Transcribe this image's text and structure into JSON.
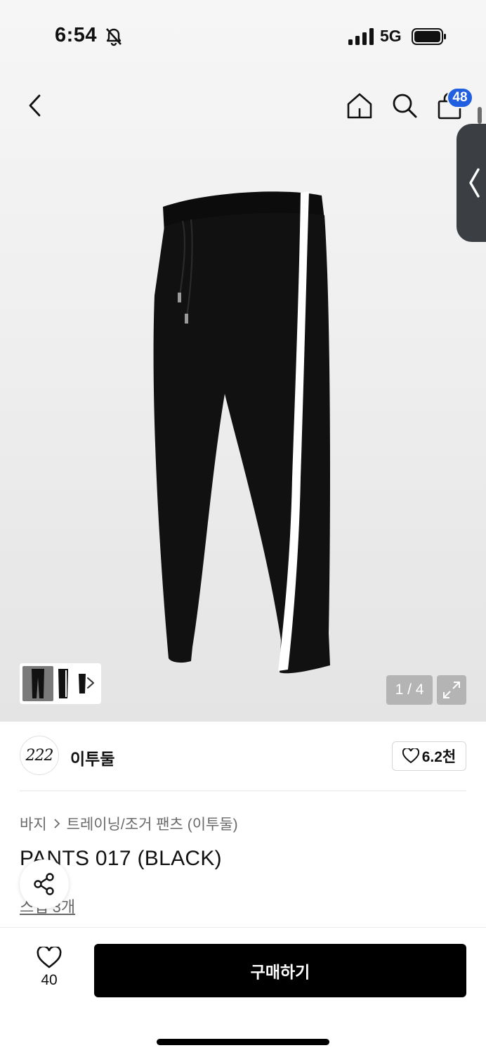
{
  "status_bar": {
    "time": "6:54",
    "network": "5G",
    "icons": [
      "bell-slash-icon",
      "signal-icon",
      "battery-icon"
    ]
  },
  "nav": {
    "cart_count": "48",
    "icons": [
      "chevron-left-icon",
      "home-icon",
      "search-icon",
      "cart-icon"
    ]
  },
  "gallery": {
    "counter": "1 / 4",
    "icons": [
      "chevron-right-icon",
      "expand-icon",
      "chevron-left-icon"
    ]
  },
  "brand": {
    "logo_text": "222",
    "name": "이투둘",
    "like_count": "6.2천"
  },
  "breadcrumb": {
    "category": "바지",
    "subcategory": "트레이닝/조거 팬츠 (이투둘)"
  },
  "product": {
    "title": "PANTS 017 (BLACK)",
    "review_link": "스냅 3개"
  },
  "bottom": {
    "wish_count": "40",
    "buy_label": "구매하기"
  },
  "colors": {
    "accent_badge": "#1f5fe0",
    "buy_button": "#000000",
    "side_tab": "#3b3f44"
  }
}
